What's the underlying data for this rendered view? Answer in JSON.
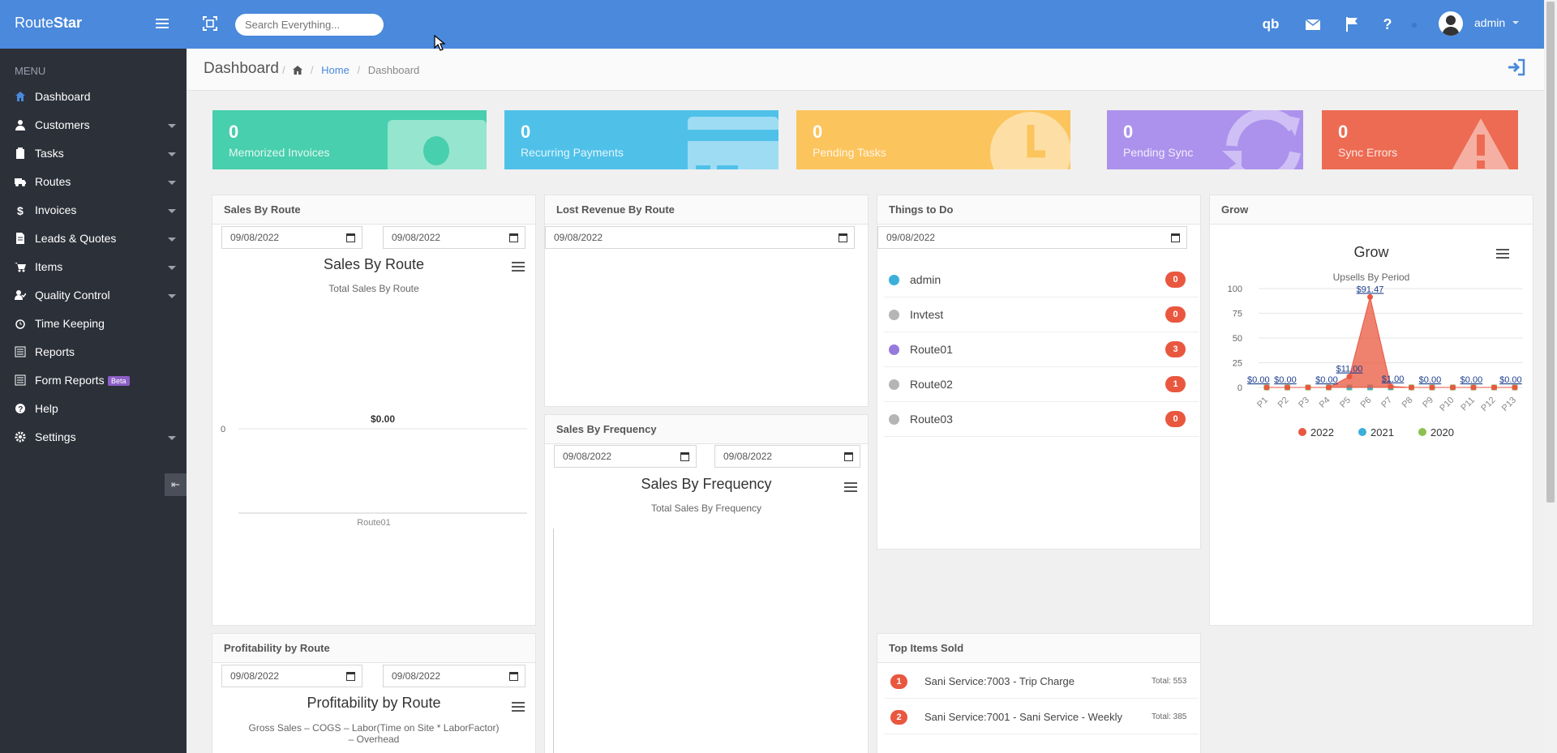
{
  "app": {
    "brand_a": "Route",
    "brand_b": "Star"
  },
  "search": {
    "placeholder": "Search Everything..."
  },
  "user": {
    "name": "admin"
  },
  "topbar_icons": [
    "quickbooks-icon",
    "mail-icon",
    "flag-icon",
    "help-icon"
  ],
  "sidebar": {
    "header": "MENU",
    "items": [
      {
        "label": "Dashboard",
        "icon": "home-icon",
        "caret": false,
        "active": true
      },
      {
        "label": "Customers",
        "icon": "user-icon",
        "caret": true
      },
      {
        "label": "Tasks",
        "icon": "clipboard-icon",
        "caret": true
      },
      {
        "label": "Routes",
        "icon": "truck-icon",
        "caret": true
      },
      {
        "label": "Invoices",
        "icon": "dollar-icon",
        "caret": true
      },
      {
        "label": "Leads & Quotes",
        "icon": "document-icon",
        "caret": true
      },
      {
        "label": "Items",
        "icon": "cart-icon",
        "caret": true
      },
      {
        "label": "Quality Control",
        "icon": "user-check-icon",
        "caret": true
      },
      {
        "label": "Time Keeping",
        "icon": "alarm-clock-icon",
        "caret": false
      },
      {
        "label": "Reports",
        "icon": "list-icon",
        "caret": false
      },
      {
        "label": "Form Reports",
        "icon": "list-icon",
        "caret": false,
        "badge": "Beta"
      },
      {
        "label": "Help",
        "icon": "question-circle-icon",
        "caret": false
      },
      {
        "label": "Settings",
        "icon": "gear-icon",
        "caret": true
      }
    ]
  },
  "header": {
    "title": "Dashboard",
    "breadcrumb": {
      "home": "Home",
      "current": "Dashboard",
      "sep": "/"
    }
  },
  "tiles": [
    {
      "value": "0",
      "label": "Memorized Invoices",
      "color": "#48cfad",
      "icon": "money-icon"
    },
    {
      "value": "0",
      "label": "Recurring Payments",
      "color": "#4fc1e9",
      "icon": "credit-card-icon"
    },
    {
      "value": "0",
      "label": "Pending Tasks",
      "color": "#fcc45d",
      "icon": "clock-icon"
    },
    {
      "value": "0",
      "label": "Pending Sync",
      "color": "#ac92ec",
      "icon": "sync-icon"
    },
    {
      "value": "0",
      "label": "Sync Errors",
      "color": "#ed6b53",
      "icon": "warning-icon"
    }
  ],
  "panels": {
    "sales_by_route": {
      "title": "Sales By Route",
      "date1": "09/08/2022",
      "date2": "09/08/2022",
      "chart_title": "Sales By Route",
      "chart_sub": "Total Sales By Route",
      "y_tick": "0",
      "data_label": "$0.00",
      "category": "Route01"
    },
    "lost_revenue": {
      "title": "Lost Revenue By Route",
      "date": "09/08/2022"
    },
    "things_to_do": {
      "title": "Things to Do",
      "date": "09/08/2022",
      "rows": [
        {
          "name": "admin",
          "count": "0",
          "color": "#3bafda"
        },
        {
          "name": "Invtest",
          "count": "0",
          "color": "#b5b5b5"
        },
        {
          "name": "Route01",
          "count": "3",
          "color": "#967adc"
        },
        {
          "name": "Route02",
          "count": "1",
          "color": "#b5b5b5"
        },
        {
          "name": "Route03",
          "count": "0",
          "color": "#b5b5b5"
        }
      ]
    },
    "grow": {
      "title": "Grow",
      "chart_title": "Grow",
      "chart_sub": "Upsells By Period"
    },
    "sales_by_frequency": {
      "title": "Sales By Frequency",
      "date1": "09/08/2022",
      "date2": "09/08/2022",
      "chart_title": "Sales By Frequency",
      "chart_sub": "Total Sales By Frequency"
    },
    "profitability": {
      "title": "Profitability by Route",
      "date1": "09/08/2022",
      "date2": "09/08/2022",
      "chart_title": "Profitability by Route",
      "chart_sub1": "Gross Sales – COGS – Labor(Time on Site * LaborFactor)",
      "chart_sub2": "– Overhead"
    },
    "top_items": {
      "title": "Top Items Sold",
      "rows": [
        {
          "rank": "1",
          "name": "Sani Service:7003 - Trip Charge",
          "total": "Total: 553"
        },
        {
          "rank": "2",
          "name": "Sani Service:7001 - Sani Service - Weekly",
          "total": "Total: 385"
        }
      ]
    }
  },
  "chart_data": [
    {
      "type": "bar",
      "title": "Sales By Route",
      "subtitle": "Total Sales By Route",
      "categories": [
        "Route01"
      ],
      "values": [
        0
      ],
      "data_labels": [
        "$0.00"
      ]
    },
    {
      "type": "area",
      "title": "Grow",
      "subtitle": "Upsells By Period",
      "categories": [
        "P1",
        "P2",
        "P3",
        "P4",
        "P5",
        "P6",
        "P7",
        "P8",
        "P9",
        "P10",
        "P11",
        "P12",
        "P13"
      ],
      "y_ticks": [
        0,
        25,
        50,
        75,
        100
      ],
      "ylim": [
        0,
        100
      ],
      "legend_position": "bottom",
      "series": [
        {
          "name": "2022",
          "color": "#e9573f",
          "values": [
            0,
            0,
            0,
            0,
            11,
            91.47,
            1,
            0,
            0,
            0,
            0,
            0,
            0
          ]
        },
        {
          "name": "2021",
          "color": "#3bafda",
          "values": [
            0,
            0,
            0,
            0,
            0,
            0,
            0,
            0,
            0,
            0,
            0,
            0,
            0
          ]
        },
        {
          "name": "2020",
          "color": "#8cc152",
          "values": [
            0,
            0,
            0,
            0,
            0,
            0,
            0,
            0,
            0,
            0,
            0,
            0,
            0
          ]
        }
      ],
      "data_labels": [
        "$0.00",
        "$0.00",
        "$0.00",
        "$11.00",
        "$91.47",
        "$1.00",
        "$0.00",
        "$0.00",
        "$0.00"
      ]
    }
  ]
}
